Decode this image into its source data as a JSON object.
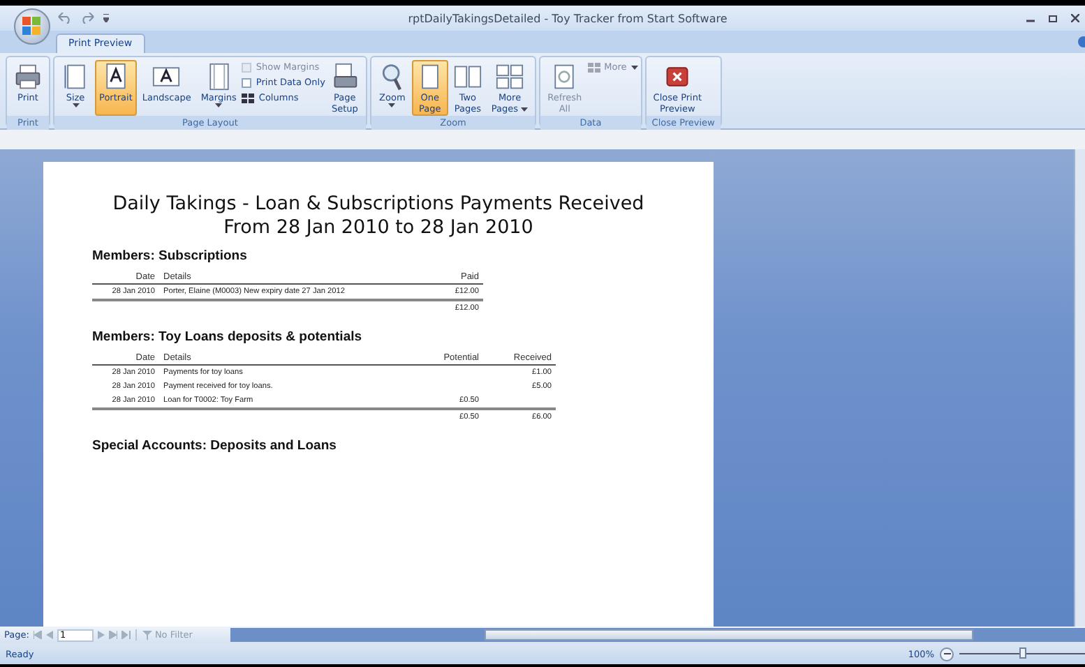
{
  "window": {
    "title": "rptDailyTakingsDetailed - Toy Tracker from Start Software"
  },
  "tabs": [
    {
      "label": "Print Preview",
      "selected": true
    }
  ],
  "ribbon_groups": [
    {
      "label": "Print",
      "items": [
        {
          "kind": "large",
          "lines": [
            "Print"
          ],
          "selected": false,
          "disabled": false,
          "dropdown": false
        }
      ]
    },
    {
      "label": "Page Layout",
      "items": [
        {
          "kind": "large",
          "lines": [
            "Size"
          ],
          "selected": false,
          "disabled": false,
          "dropdown": true
        },
        {
          "kind": "large",
          "lines": [
            "Portrait"
          ],
          "selected": true,
          "disabled": false,
          "dropdown": false
        },
        {
          "kind": "large",
          "lines": [
            "Landscape"
          ],
          "selected": false,
          "disabled": false,
          "dropdown": false
        },
        {
          "kind": "large",
          "lines": [
            "Margins"
          ],
          "selected": false,
          "disabled": false,
          "dropdown": true
        },
        {
          "kind": "stack",
          "items": [
            {
              "kind": "check",
              "label": "Show Margins",
              "checked": false,
              "disabled": true
            },
            {
              "kind": "check",
              "label": "Print Data Only",
              "checked": false,
              "disabled": false
            },
            {
              "kind": "small",
              "label": "Columns",
              "disabled": false
            }
          ]
        },
        {
          "kind": "large",
          "lines": [
            "Page",
            "Setup"
          ],
          "selected": false,
          "disabled": false,
          "dropdown": false
        }
      ]
    },
    {
      "label": "Zoom",
      "items": [
        {
          "kind": "large",
          "lines": [
            "Zoom"
          ],
          "selected": false,
          "disabled": false,
          "dropdown": true
        },
        {
          "kind": "large",
          "lines": [
            "One",
            "Page"
          ],
          "selected": true,
          "disabled": false,
          "dropdown": false
        },
        {
          "kind": "large",
          "lines": [
            "Two",
            "Pages"
          ],
          "selected": false,
          "disabled": false,
          "dropdown": false
        },
        {
          "kind": "large",
          "lines": [
            "More",
            "Pages"
          ],
          "selected": false,
          "disabled": false,
          "dropdown": true
        }
      ]
    },
    {
      "label": "Data",
      "items": [
        {
          "kind": "large",
          "lines": [
            "Refresh",
            "All"
          ],
          "selected": false,
          "disabled": true,
          "dropdown": false
        },
        {
          "kind": "stack",
          "items": [
            {
              "kind": "small",
              "label": "More",
              "disabled": true,
              "dropdown": true
            }
          ]
        }
      ]
    },
    {
      "label": "Close Preview",
      "items": [
        {
          "kind": "large",
          "lines": [
            "Close Print",
            "Preview"
          ],
          "selected": false,
          "disabled": false,
          "dropdown": false
        }
      ]
    }
  ],
  "report": {
    "title_lines": [
      "Daily Takings - Loan & Subscriptions Payments Received",
      "From 28 Jan 2010 to 28 Jan 2010"
    ],
    "sections": [
      {
        "heading": "Members: Subscriptions",
        "columns": [
          "Date",
          "Details",
          "Paid"
        ],
        "rows": [
          [
            "28 Jan 2010",
            "Porter, Elaine (M0003) New expiry date 27 Jan 2012",
            "£12.00"
          ]
        ],
        "totals": [
          "£12.00"
        ]
      },
      {
        "heading": "Members: Toy Loans deposits & potentials",
        "columns": [
          "Date",
          "Details",
          "Potential",
          "Received"
        ],
        "rows": [
          [
            "28 Jan 2010",
            "Payments for toy loans",
            "",
            "£1.00"
          ],
          [
            "28 Jan 2010",
            "Payment received for toy loans.",
            "",
            "£5.00"
          ],
          [
            "28 Jan 2010",
            "Loan for T0002: Toy Farm",
            "£0.50",
            ""
          ]
        ],
        "totals": [
          "£0.50",
          "£6.00"
        ]
      },
      {
        "heading": "Special Accounts: Deposits and Loans"
      }
    ]
  },
  "navigation": {
    "label": "Page:",
    "page_field": "1",
    "filter": "No Filter"
  },
  "status_bar": {
    "text": "Ready",
    "zoom": "100%",
    "level": 0.5
  }
}
